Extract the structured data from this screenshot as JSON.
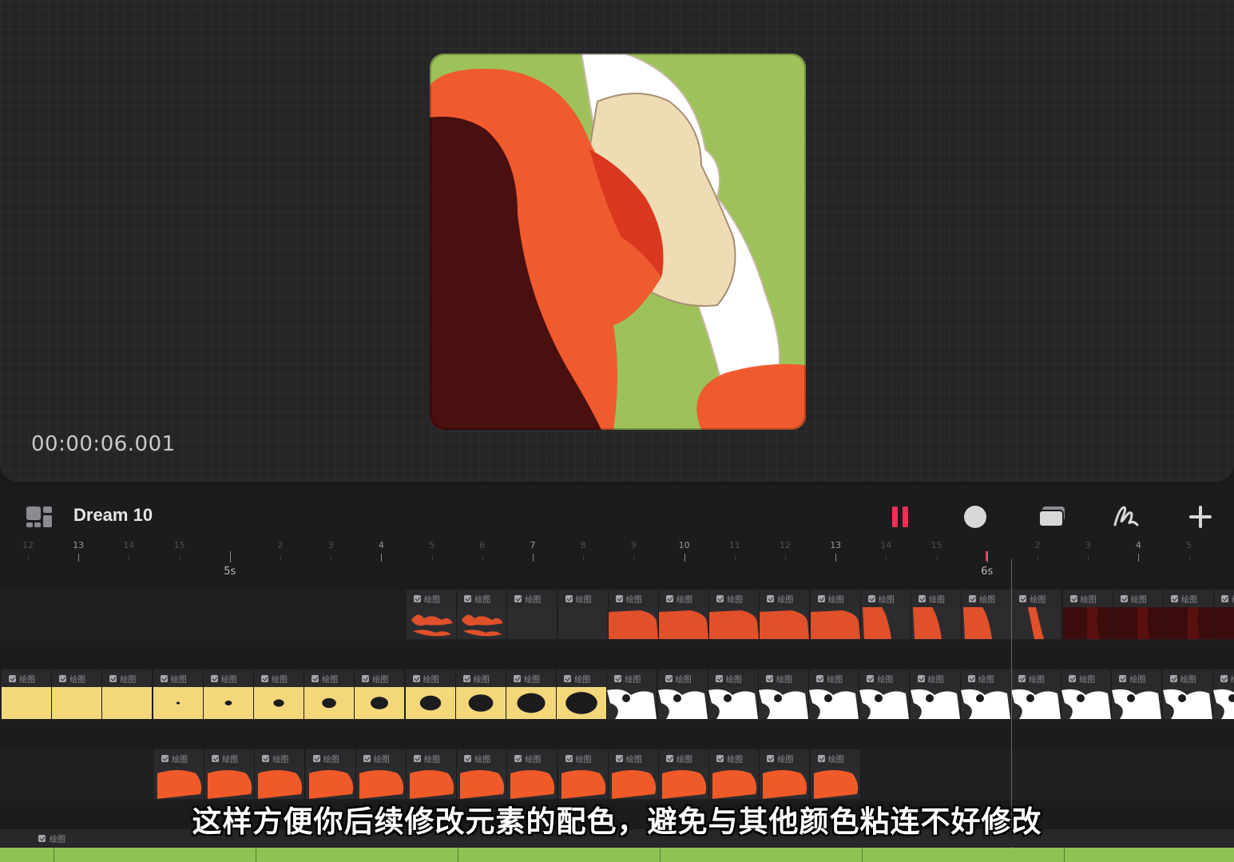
{
  "preview": {
    "timecode": "00:00:06.001",
    "colors": {
      "background": "#9dc25a",
      "red": "#f05a2f",
      "dark_red": "#4a0f0f",
      "skin": "#efdcb4",
      "white": "#ffffff"
    }
  },
  "toolbar": {
    "layout_icon": "grid-layout-icon",
    "title": "Dream 10",
    "pause_icon": "pause-icon",
    "record_icon": "record-circle-icon",
    "onion_icon": "onion-skin-layers-icon",
    "draw_icon": "brush-stroke-icon",
    "add_icon": "plus-icon",
    "accent_color": "#ff2d55"
  },
  "ruler": {
    "ticks": [
      {
        "label": "12",
        "dim": true
      },
      {
        "label": "13",
        "dim": false
      },
      {
        "label": "14",
        "dim": true
      },
      {
        "label": "15",
        "dim": true
      },
      {
        "label": "",
        "dim": false,
        "major": true
      },
      {
        "label": "2",
        "dim": true
      },
      {
        "label": "3",
        "dim": true
      },
      {
        "label": "4",
        "dim": false
      },
      {
        "label": "5",
        "dim": true
      },
      {
        "label": "6",
        "dim": true
      },
      {
        "label": "7",
        "dim": false
      },
      {
        "label": "8",
        "dim": true
      },
      {
        "label": "9",
        "dim": true
      },
      {
        "label": "10",
        "dim": false
      },
      {
        "label": "11",
        "dim": true
      },
      {
        "label": "12",
        "dim": true
      },
      {
        "label": "13",
        "dim": false
      },
      {
        "label": "14",
        "dim": true
      },
      {
        "label": "15",
        "dim": true
      },
      {
        "label": "",
        "dim": false,
        "major": true
      },
      {
        "label": "2",
        "dim": true
      },
      {
        "label": "3",
        "dim": true
      },
      {
        "label": "4",
        "dim": false
      },
      {
        "label": "5",
        "dim": true
      }
    ],
    "seconds": [
      "5s",
      "6s"
    ]
  },
  "tracks": [
    {
      "name": "red-layer-track",
      "cell_label": "绘图",
      "count": 17,
      "thumb_bg": "#2c2c2e",
      "fill": "#e0502a",
      "kinds": [
        "splash",
        "splash",
        "empty",
        "empty",
        "block",
        "block",
        "block",
        "block",
        "block",
        "part",
        "part",
        "part",
        "thin",
        "dark",
        "dark",
        "dark",
        "dark"
      ]
    },
    {
      "name": "white-layer-track",
      "cell_label": "绘图",
      "count": 25,
      "thumb_bg": "#f4d77b",
      "fill": "#ffffff",
      "kinds": [
        "y",
        "y",
        "y",
        "y",
        "y",
        "y",
        "y",
        "y",
        "y",
        "y",
        "y",
        "y",
        "w",
        "w",
        "w",
        "w",
        "w",
        "w",
        "w",
        "w",
        "w",
        "w",
        "w",
        "w",
        "w"
      ]
    },
    {
      "name": "orange-layer-track",
      "cell_label": "绘图",
      "count": 14,
      "thumb_bg": "#2c2c2e",
      "fill": "#f05a28",
      "kinds": [
        "blob",
        "blob",
        "blob",
        "blob",
        "blob",
        "blob",
        "blob",
        "blob",
        "blob",
        "blob",
        "blob",
        "blob",
        "blob",
        "blob"
      ]
    }
  ],
  "bottom_track": {
    "cell_label": "绘图",
    "color": "#8fc153"
  },
  "subtitle": "这样方便你后续修改元素的配色，避免与其他颜色粘连不好修改"
}
